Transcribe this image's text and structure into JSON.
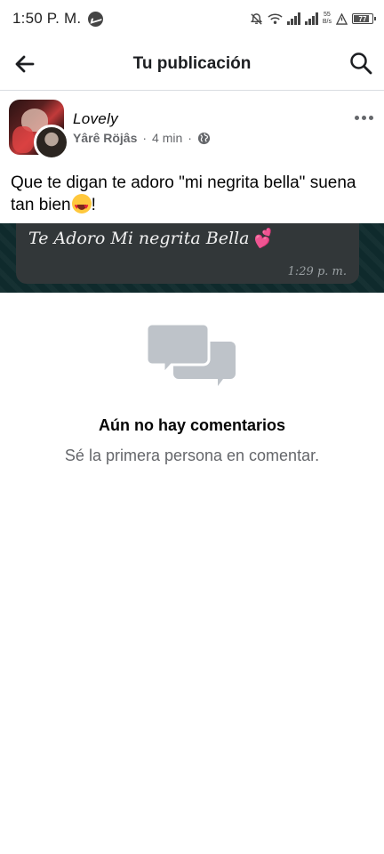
{
  "status_bar": {
    "time": "1:50 P. M.",
    "net_speed_value": "55",
    "net_speed_unit": "B/s",
    "battery_level": "77",
    "icons": [
      "messenger-icon",
      "mute-icon",
      "wifi-icon",
      "signal-icon",
      "signal-icon",
      "alert-icon",
      "battery-icon"
    ]
  },
  "header": {
    "title": "Tu publicación",
    "back_icon": "arrow-left-icon",
    "search_icon": "search-icon"
  },
  "post": {
    "group_name": "Lovely",
    "author": "Yârê Röjâs",
    "separator": "·",
    "time_ago": "4 min",
    "privacy_icon": "globe-icon",
    "text": "Que te digan te adoro \"mi negrita bella\" suena tan bien",
    "text_suffix": "!",
    "emoji": "heart-eyes-emoji",
    "image": {
      "message_text": "Te Adoro Mi negrita Bella",
      "message_emoji": "💕",
      "message_time": "1:29 p. m."
    }
  },
  "comments": {
    "empty_title": "Aún no hay comentarios",
    "empty_subtitle": "Sé la primera persona en comentar.",
    "icon": "comments-icon"
  },
  "colors": {
    "text_primary": "#050505",
    "text_secondary": "#65676b",
    "divider": "#dadde1",
    "placeholder_icon": "#bec3c9"
  }
}
